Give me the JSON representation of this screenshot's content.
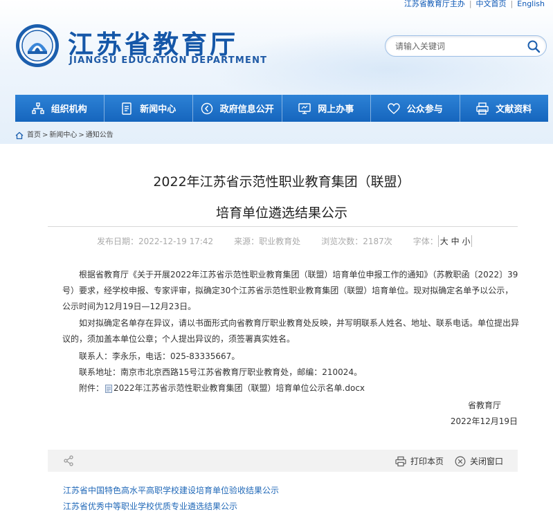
{
  "top_links": {
    "sponsor": "江苏省教育厅主办",
    "chinese": "中文首页",
    "english": "English"
  },
  "brand": {
    "name_cn": "江苏省教育厅",
    "name_en": "JIANGSU EDUCATION DEPARTMENT"
  },
  "search": {
    "placeholder": "请输入关键词"
  },
  "nav": {
    "items": [
      {
        "label": "组织机构",
        "icon": "org-icon"
      },
      {
        "label": "新闻中心",
        "icon": "news-icon"
      },
      {
        "label": "政府信息公开",
        "icon": "info-icon"
      },
      {
        "label": "网上办事",
        "icon": "monitor-icon"
      },
      {
        "label": "公众参与",
        "icon": "heart-icon"
      },
      {
        "label": "文献资料",
        "icon": "printer-icon"
      }
    ]
  },
  "breadcrumb": {
    "home": "首页",
    "level1": "新闻中心",
    "level2": "通知公告",
    "sep": ">"
  },
  "article": {
    "title_line1": "2022年江苏省示范性职业教育集团（联盟）",
    "title_line2": "培育单位遴选结果公示",
    "meta": {
      "date_label": "发布日期：",
      "date": "2022-12-19 17:42",
      "source_label": "来源：",
      "source": "职业教育处",
      "views_label": "浏览次数：",
      "views": "2187次",
      "font_label": "字体：",
      "font_large": "大",
      "font_medium": "中",
      "font_small": "小"
    },
    "p1": "根据省教育厅《关于开展2022年江苏省示范性职业教育集团（联盟）培育单位申报工作的通知》（苏教职函〔2022〕39号）要求，经学校申报、专家评审，拟确定30个江苏省示范性职业教育集团（联盟）培育单位。现对拟确定名单予以公示，公示时间为12月19日—12月23日。",
    "p2": "如对拟确定名单存在异议，请以书面形式向省教育厅职业教育处反映，并写明联系人姓名、地址、联系电话。单位提出异议的，须加盖本单位公章；个人提出异议的，须签署真实姓名。",
    "contact": "联系人：李永乐，电话：025-83335667。",
    "address": "联系地址：南京市北京西路15号江苏省教育厅职业教育处，邮编：210024。",
    "attachment_label": "附件：",
    "attachment_name": "2022年江苏省示范性职业教育集团（联盟）培育单位公示名单.docx",
    "signer": "省教育厅",
    "sign_date": "2022年12月19日"
  },
  "toolbar": {
    "print": "打印本页",
    "close": "关闭窗口"
  },
  "related": [
    "江苏省中国特色高水平高职学校建设培育单位验收结果公示",
    "江苏省优秀中等职业学校优质专业遴选结果公示"
  ],
  "colors": {
    "nav_blue": "#1a6cc4",
    "brand_blue": "#1557a8",
    "link_blue": "#2169b8"
  }
}
